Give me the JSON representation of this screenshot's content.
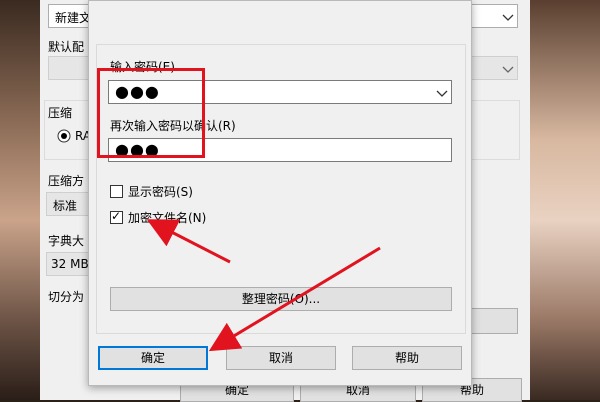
{
  "parent": {
    "archive_name_combo": "新建文",
    "default_profile_label": "默认配",
    "compress_group_label": "压缩",
    "radio_label": "RA",
    "method_label": "压缩方",
    "method_value": "标准",
    "dict_label": "字典大",
    "dict_value": "32 MB",
    "split_label": "切分为",
    "ok_label": "确定",
    "cancel_label": "取消",
    "help_label": "帮助"
  },
  "dialog": {
    "password_label": "输入密码(E)",
    "password_value": "●●●",
    "confirm_label": "再次输入密码以确认(R)",
    "confirm_value": "●●●",
    "show_password_label": "显示密码(S)",
    "show_password_checked": false,
    "encrypt_names_label": "加密文件名(N)",
    "encrypt_names_checked": true,
    "check_mark": "✓",
    "organize_button_label": "整理密码(O)...",
    "ok_label": "确定",
    "cancel_label": "取消",
    "help_label": "帮助"
  },
  "colors": {
    "annotation": "#e0131e",
    "default_button_border": "#0078d7"
  }
}
